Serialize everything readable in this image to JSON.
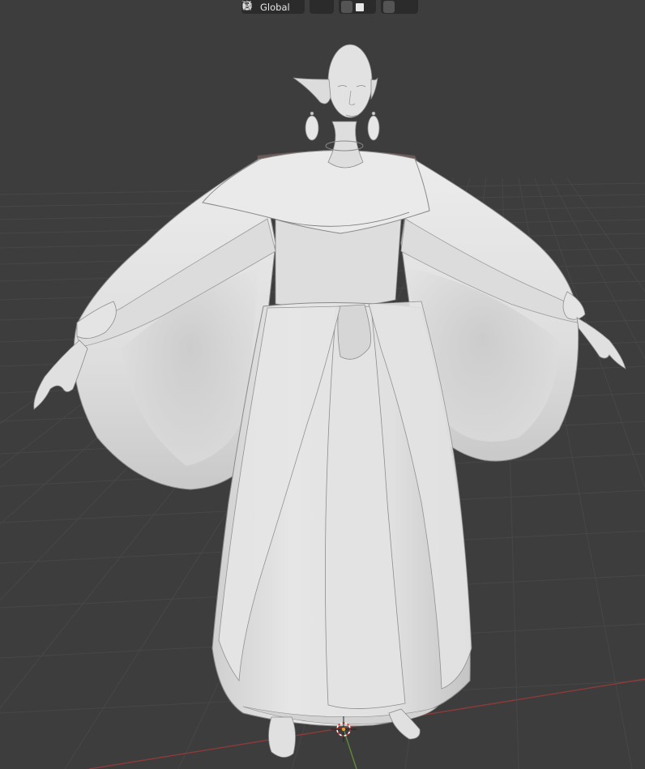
{
  "header": {
    "orientation": {
      "label": "Global",
      "icon": "transform-orientation-icon"
    },
    "pivot": {
      "icon": "pivot-point-icon"
    },
    "snapping": {
      "icon": "snap-magnet-icon",
      "increment_icon": "snap-increment-icon"
    },
    "proportional_editing": {
      "icon": "proportional-editing-icon",
      "falloff_icon": "falloff-curve-icon"
    }
  },
  "viewport": {
    "background": "#3d3d3d",
    "grid_color": "#4a4a4a",
    "x_axis_color": "#9a3b3b",
    "y_axis_color": "#5f8f3a",
    "model_color": "#d8d8d8",
    "model_subject": "elf-woman-in-robe-and-cape",
    "cursor_icon": "3d-cursor-icon"
  }
}
